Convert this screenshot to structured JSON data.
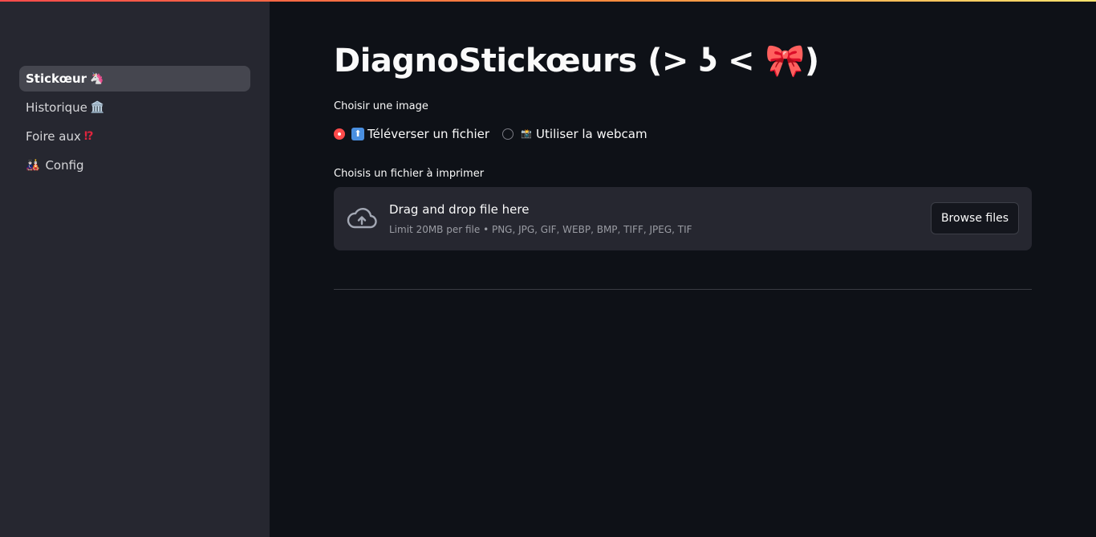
{
  "sidebar": {
    "items": [
      {
        "label": "Stickœur",
        "icon": "🦄"
      },
      {
        "label": "Historique",
        "icon": "🏛️"
      },
      {
        "label": "Foire aux",
        "icon": "⁉"
      },
      {
        "label": "Config",
        "icon": "🎎"
      }
    ]
  },
  "main": {
    "title": "DiagnoStickœurs (> ʖ <",
    "title_emoji": "🎀",
    "title_close": ")",
    "image_choice_label": "Choisir une image",
    "radio_options": [
      {
        "label": "Téléverser un fichier",
        "icon": "⬆",
        "selected": true
      },
      {
        "label": "Utiliser la webcam",
        "icon": "📸",
        "selected": false
      }
    ],
    "file_label": "Choisis un fichier à imprimer",
    "dropzone": {
      "title": "Drag and drop file here",
      "limit": "Limit 20MB per file • PNG, JPG, GIF, WEBP, BMP, TIFF, JPEG, TIF",
      "browse_label": "Browse files"
    }
  },
  "colors": {
    "accent": "#ff4b4b",
    "background": "#0e1117",
    "sidebar": "#262730"
  }
}
